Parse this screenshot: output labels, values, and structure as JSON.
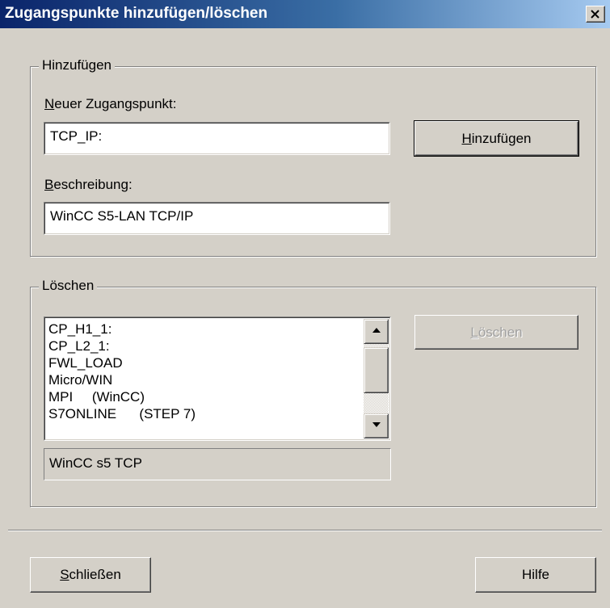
{
  "window": {
    "title": "Zugangspunkte hinzufügen/löschen",
    "close_glyph": "close-icon"
  },
  "add_group": {
    "legend": "Hinzufügen",
    "new_access_point_label_mnemonic": "N",
    "new_access_point_label_rest": "euer Zugangspunkt:",
    "new_access_point_value": "TCP_IP:",
    "description_label_mnemonic": "B",
    "description_label_rest": "eschreibung:",
    "description_value": "WinCC S5-LAN TCP/IP",
    "add_button_mnemonic": "H",
    "add_button_rest": "inzufügen"
  },
  "delete_group": {
    "legend": "Löschen",
    "access_points": [
      "CP_H1_1:",
      "CP_L2_1:",
      "FWL_LOAD",
      "Micro/WIN",
      "MPI     (WinCC)",
      "S7ONLINE      (STEP 7)"
    ],
    "selected_description": "WinCC s5 TCP",
    "delete_button_mnemonic": "L",
    "delete_button_rest": "öschen",
    "delete_button_enabled": false
  },
  "footer": {
    "close_button_mnemonic": "S",
    "close_button_rest": "chließen",
    "help_button": "Hilfe"
  },
  "colors": {
    "dialog_bg": "#d4d0c8",
    "title_gradient_start": "#0a246a",
    "title_gradient_end": "#a6caf0",
    "disabled_text": "#a0a0a0"
  }
}
